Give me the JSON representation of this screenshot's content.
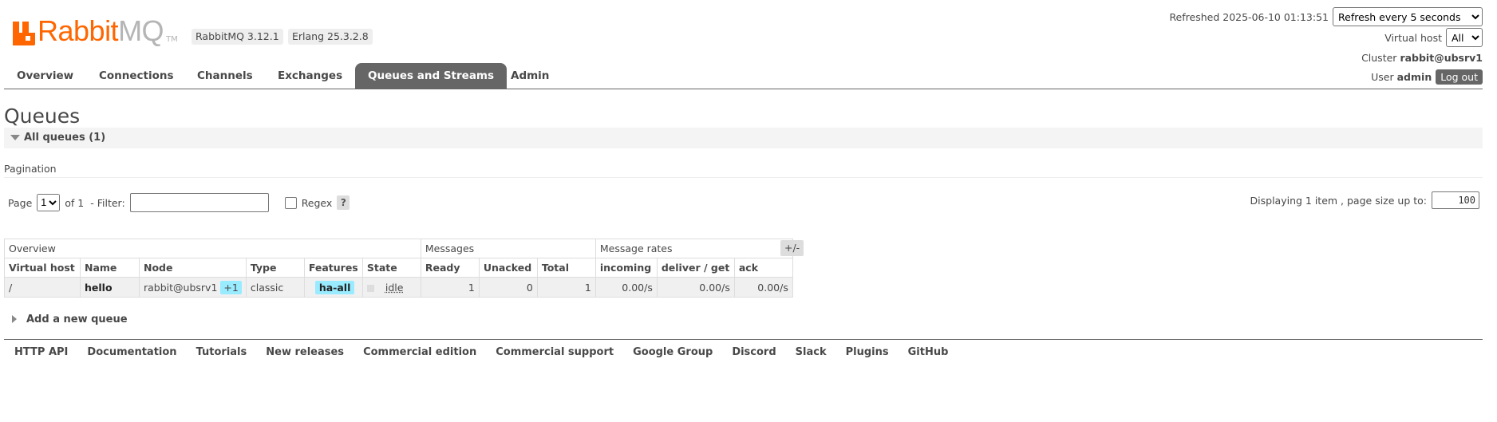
{
  "header": {
    "logo_rabbit": "Rabbit",
    "logo_mq": "MQ",
    "logo_tm": "TM",
    "rabbitmq_version": "RabbitMQ 3.12.1",
    "erlang_version": "Erlang 25.3.2.8",
    "refreshed_label": "Refreshed 2025-06-10 01:13:51",
    "refresh_interval": "Refresh every 5 seconds",
    "vhost_label": "Virtual host",
    "vhost_value": "All",
    "cluster_label": "Cluster",
    "cluster_value": "rabbit@ubsrv1",
    "user_label": "User",
    "user_value": "admin",
    "logout_label": "Log out"
  },
  "nav": {
    "items": [
      "Overview",
      "Connections",
      "Channels",
      "Exchanges",
      "Queues and Streams",
      "Admin"
    ],
    "active": "Queues and Streams"
  },
  "page": {
    "title": "Queues",
    "section_label": "All queues (1)",
    "pagination_label": "Pagination",
    "page_label": "Page",
    "page_value": "1",
    "of_label": "of 1",
    "filter_label": "- Filter:",
    "filter_value": "",
    "regex_label": "Regex",
    "help_label": "?",
    "display_info": "Displaying 1 item , page size up to:",
    "page_size": "100",
    "plus_minus": "+/-",
    "add_queue_label": "Add a new queue"
  },
  "table": {
    "groups": [
      "Overview",
      "Messages",
      "Message rates"
    ],
    "columns": [
      "Virtual host",
      "Name",
      "Node",
      "Type",
      "Features",
      "State",
      "Ready",
      "Unacked",
      "Total",
      "incoming",
      "deliver / get",
      "ack"
    ],
    "rows": [
      {
        "vhost": "/",
        "name": "hello",
        "node": "rabbit@ubsrv1",
        "node_extra": "+1",
        "type": "classic",
        "features": "ha-all",
        "state": "idle",
        "ready": "1",
        "unacked": "0",
        "total": "1",
        "incoming": "0.00/s",
        "deliver_get": "0.00/s",
        "ack": "0.00/s"
      }
    ]
  },
  "footer": {
    "links": [
      "HTTP API",
      "Documentation",
      "Tutorials",
      "New releases",
      "Commercial edition",
      "Commercial support",
      "Google Group",
      "Discord",
      "Slack",
      "Plugins",
      "GitHub"
    ]
  },
  "colors": {
    "brand_orange": "#ff6600",
    "nav_active": "#666666",
    "tag_blue": "#99ebff"
  }
}
